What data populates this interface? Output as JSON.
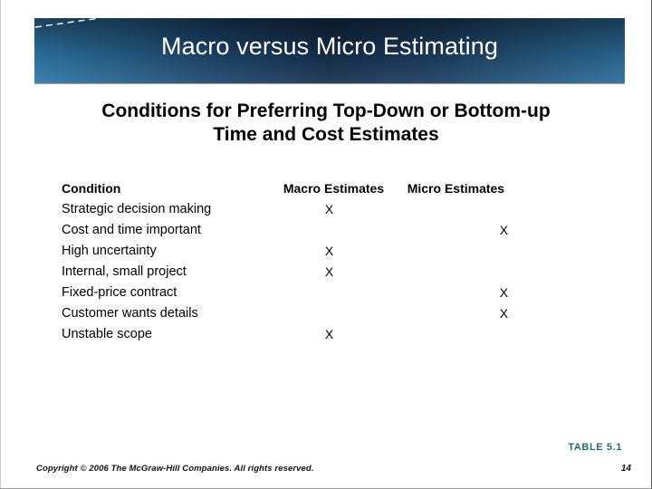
{
  "slide": {
    "title": "Macro versus Micro Estimating",
    "subtitle_line1": "Conditions for Preferring Top-Down or Bottom-up",
    "subtitle_line2": "Time and Cost Estimates",
    "banner_accent_color": "#1b3f63",
    "table_ref_color": "#1f6b6b"
  },
  "table": {
    "headers": {
      "condition": "Condition",
      "macro": "Macro Estimates",
      "micro": "Micro Estimates"
    },
    "mark": "X",
    "rows": [
      {
        "condition": "Strategic decision making",
        "macro": "X",
        "micro": ""
      },
      {
        "condition": "Cost and time important",
        "macro": "",
        "micro": "X"
      },
      {
        "condition": "High uncertainty",
        "macro": "X",
        "micro": ""
      },
      {
        "condition": "Internal, small project",
        "macro": "X",
        "micro": ""
      },
      {
        "condition": "Fixed-price contract",
        "macro": "",
        "micro": "X"
      },
      {
        "condition": "Customer wants details",
        "macro": "",
        "micro": "X"
      },
      {
        "condition": "Unstable scope",
        "macro": "X",
        "micro": ""
      }
    ]
  },
  "footer": {
    "table_reference": "TABLE 5.1",
    "copyright": "Copyright © 2006 The McGraw-Hill Companies. All rights reserved.",
    "page_number": "14"
  }
}
